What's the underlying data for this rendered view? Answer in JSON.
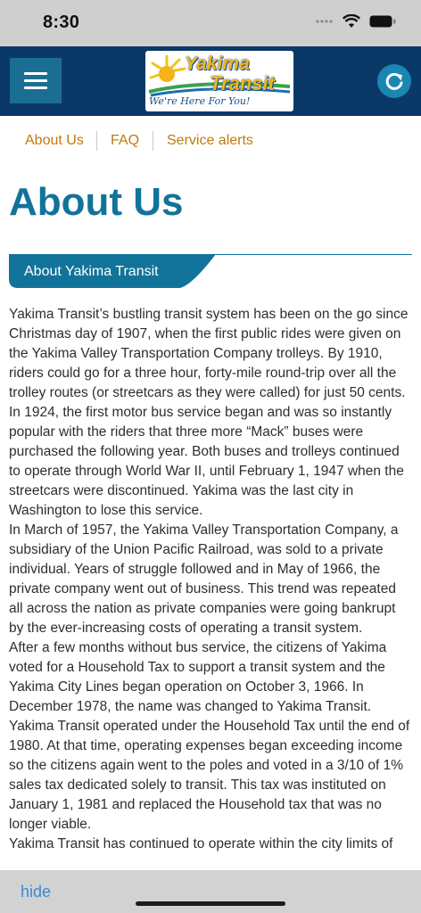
{
  "status_bar": {
    "time": "8:30"
  },
  "header": {
    "logo_line1": "Yakima",
    "logo_line2": "Transit",
    "logo_tagline": "We're Here For You!"
  },
  "subnav": {
    "items": [
      "About Us",
      "FAQ",
      "Service alerts"
    ]
  },
  "page": {
    "title": "About Us",
    "section_label": "About Yakima Transit",
    "paragraphs": [
      "Yakima Transit’s bustling transit system has been on the go since Christmas day of 1907, when the first public rides were given on the Yakima Valley Transportation Company trolleys. By 1910, riders could go for a three hour, forty-mile round-trip over all the trolley routes (or streetcars as they were called) for just 50 cents.",
      "In 1924, the first motor bus service began and was so instantly popular with the riders that three more “Mack” buses were purchased the following year. Both buses and trolleys continued to operate through World War II, until February 1, 1947 when the streetcars were discontinued. Yakima was the last city in Washington to lose this service.",
      "In March of 1957, the Yakima Valley Transportation Company, a subsidiary of the Union Pacific Railroad, was sold to a private individual. Years of struggle followed and in May of 1966, the private company went out of business. This trend was repeated all across the nation as private companies were going bankrupt by the ever-increasing costs of operating a transit system.",
      "After a few months without bus service, the citizens of Yakima voted for a Household Tax to support a transit system and the Yakima City Lines began operation on October 3, 1966. In December 1978, the name was changed to Yakima Transit. Yakima Transit operated under the Household Tax until the end of 1980. At that time, operating expenses began exceeding income so the citizens again went to the poles and voted in a 3/10 of 1% sales tax dedicated solely to transit. This tax was instituted on January 1, 1981 and replaced the Household tax that was no longer viable.",
      "Yakima Transit has continued to operate within the city limits of"
    ]
  },
  "bottom_bar": {
    "hide_label": "hide"
  },
  "colors": {
    "header_bg": "#0a3968",
    "accent": "#12739a",
    "link": "#c07a10",
    "menu_bg": "#1a6e93"
  }
}
